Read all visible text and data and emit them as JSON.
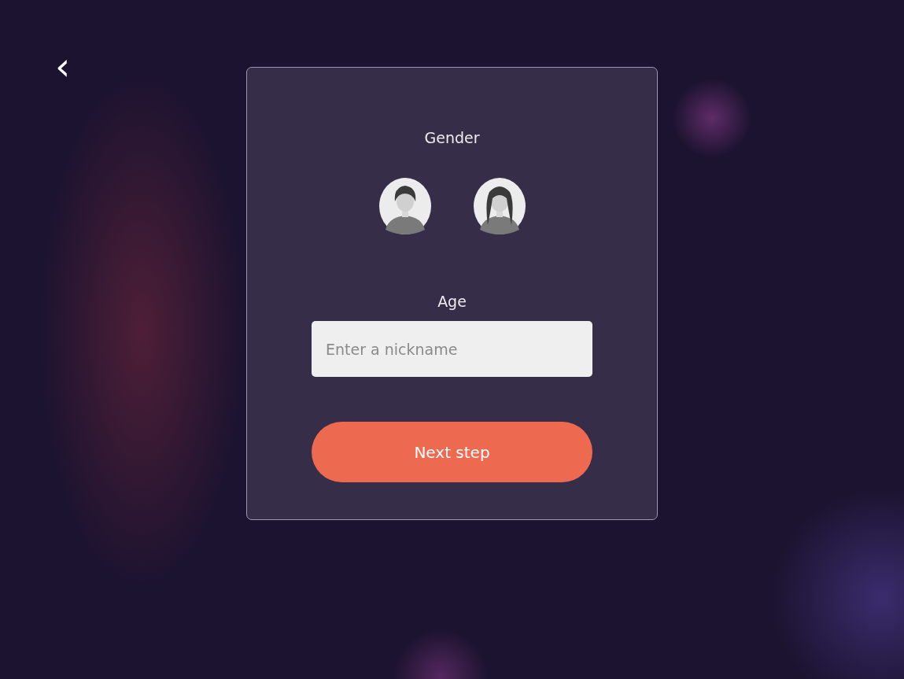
{
  "back_button": {
    "label": "‹"
  },
  "gender": {
    "label": "Gender",
    "options": [
      {
        "kind": "male",
        "selected": false
      },
      {
        "kind": "female",
        "selected": false
      }
    ]
  },
  "age": {
    "label": "Age",
    "placeholder": "Enter a nickname"
  },
  "next_button": {
    "label": "Next step"
  }
}
